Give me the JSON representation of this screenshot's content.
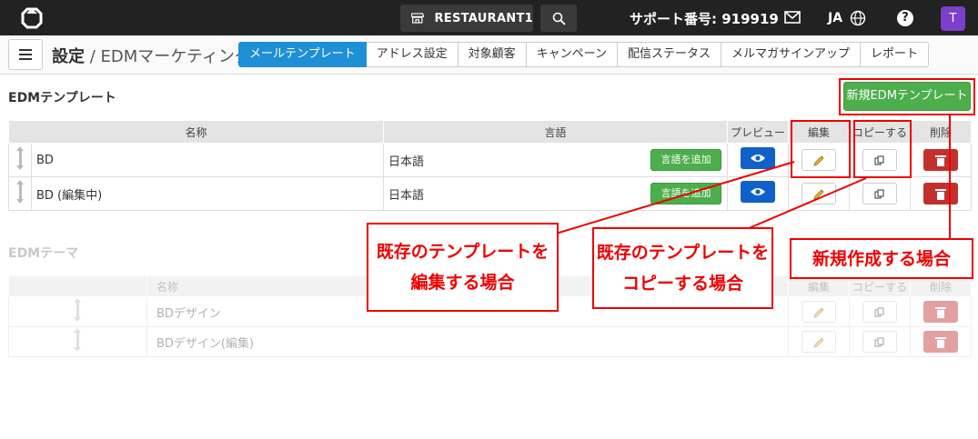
{
  "topbar": {
    "shop_name": "RESTAURANT1",
    "support": "サポート番号: 919919",
    "language": "JA",
    "help": "?",
    "avatar_letter": "T"
  },
  "header": {
    "title_main": "設定",
    "title_sep": " / ",
    "title_sub": "EDMマーケティング",
    "tabs": [
      {
        "label": "メールテンプレート",
        "active": true
      },
      {
        "label": "アドレス設定"
      },
      {
        "label": "対象顧客"
      },
      {
        "label": "キャンペーン"
      },
      {
        "label": "配信ステータス"
      },
      {
        "label": "メルマガサインアップ"
      },
      {
        "label": "レポート"
      }
    ]
  },
  "templates": {
    "title": "EDMテンプレート",
    "new_button": "新規EDMテンプレート",
    "columns": {
      "name": "名称",
      "lang": "言語",
      "preview": "プレビュー",
      "edit": "編集",
      "copy": "コピーする",
      "delete": "削除"
    },
    "add_lang_label": "言語を追加",
    "rows": [
      {
        "name": "BD",
        "lang": "日本語"
      },
      {
        "name": "BD (編集中)",
        "lang": "日本語"
      }
    ]
  },
  "themes": {
    "title": "EDMテーマ",
    "columns": {
      "name": "名称",
      "edit": "編集",
      "copy": "コピーする",
      "delete": "削除"
    },
    "rows": [
      {
        "name": "BDデザイン"
      },
      {
        "name": "BDデザイン(編集)"
      }
    ]
  },
  "annotations": {
    "edit_l1": "既存のテンプレートを",
    "edit_l2": "編集する場合",
    "copy_l1": "既存のテンプレートを",
    "copy_l2": "コピーする場合",
    "new": "新規作成する場合",
    "color": "#e00000"
  },
  "colors": {
    "active_tab": "#1f8fd6",
    "green": "#4cae4c",
    "preview_blue": "#1060c9",
    "delete_red": "#c0312e",
    "topbar": "#222222",
    "avatar": "#7c3fc9"
  }
}
